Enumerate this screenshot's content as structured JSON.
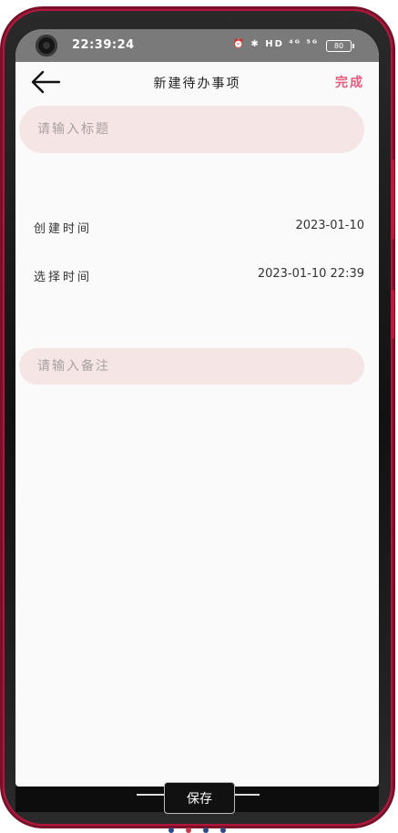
{
  "status_bar": {
    "time": "22:39:24",
    "icons_text": "⏰ ✱ HD ⁴ᴳ ⁵ᴳ",
    "battery": "80"
  },
  "app_bar": {
    "title": "新建待办事项",
    "done_label": "完成"
  },
  "form": {
    "title_placeholder": "请输入标题",
    "created_label": "创建时间",
    "created_value": "2023-01-10",
    "select_label": "选择时间",
    "select_value": "2023-01-10 22:39",
    "note_placeholder": "请输入备注"
  },
  "footer": {
    "save_label": "保存"
  },
  "colors": {
    "accent": "#e85a7b",
    "pill_bg": "#f5e5e5",
    "frame": "#b3163c"
  },
  "page_dots": [
    "#2d4a8a",
    "#c8384a",
    "#2d4a8a",
    "#2d4a8a"
  ]
}
